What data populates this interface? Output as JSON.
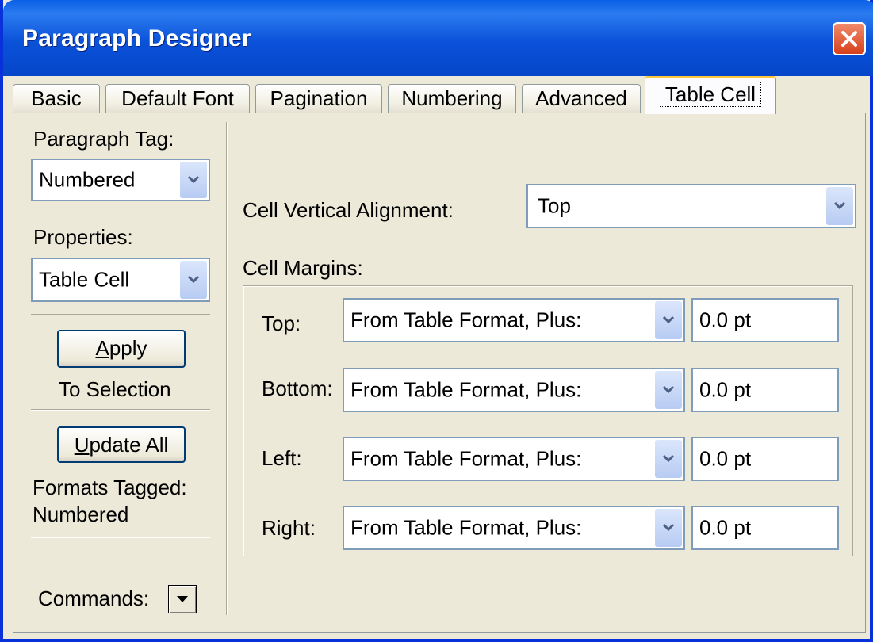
{
  "window": {
    "title": "Paragraph Designer"
  },
  "tabs": [
    {
      "label": "Basic",
      "active": false
    },
    {
      "label": "Default Font",
      "active": false
    },
    {
      "label": "Pagination",
      "active": false
    },
    {
      "label": "Numbering",
      "active": false
    },
    {
      "label": "Advanced",
      "active": false
    },
    {
      "label": "Table Cell",
      "active": true
    }
  ],
  "left": {
    "paragraph_tag_label": "Paragraph Tag:",
    "paragraph_tag_value": "Numbered",
    "properties_label": "Properties:",
    "properties_value": "Table Cell",
    "apply_label_prefix": "",
    "apply_label_accel": "A",
    "apply_label_rest": "pply",
    "to_selection": "To Selection",
    "update_all_accel": "U",
    "update_all_rest": "pdate All",
    "formats_tagged": "Formats Tagged:",
    "formats_tagged_value": "Numbered",
    "commands_label": "Commands:"
  },
  "right": {
    "cell_vertical_alignment_label": "Cell Vertical Alignment:",
    "cell_vertical_alignment_value": "Top",
    "cell_margins_label": "Cell Margins:",
    "margins": [
      {
        "label": "Top:",
        "source": "From Table Format, Plus:",
        "value": "0.0 pt"
      },
      {
        "label": "Bottom:",
        "source": "From Table Format, Plus:",
        "value": "0.0 pt"
      },
      {
        "label": "Left:",
        "source": "From Table Format, Plus:",
        "value": "0.0 pt"
      },
      {
        "label": "Right:",
        "source": "From Table Format, Plus:",
        "value": "0.0 pt"
      }
    ]
  },
  "icons": {
    "close": "close-icon",
    "dropdown": "chevron-down-icon",
    "commands": "triangle-down-icon"
  },
  "colors": {
    "titlebar": "#0a52d9",
    "dialog_bg": "#ece9d8",
    "close_button": "#d7401b",
    "active_tab_accent": "#ffc83c"
  }
}
